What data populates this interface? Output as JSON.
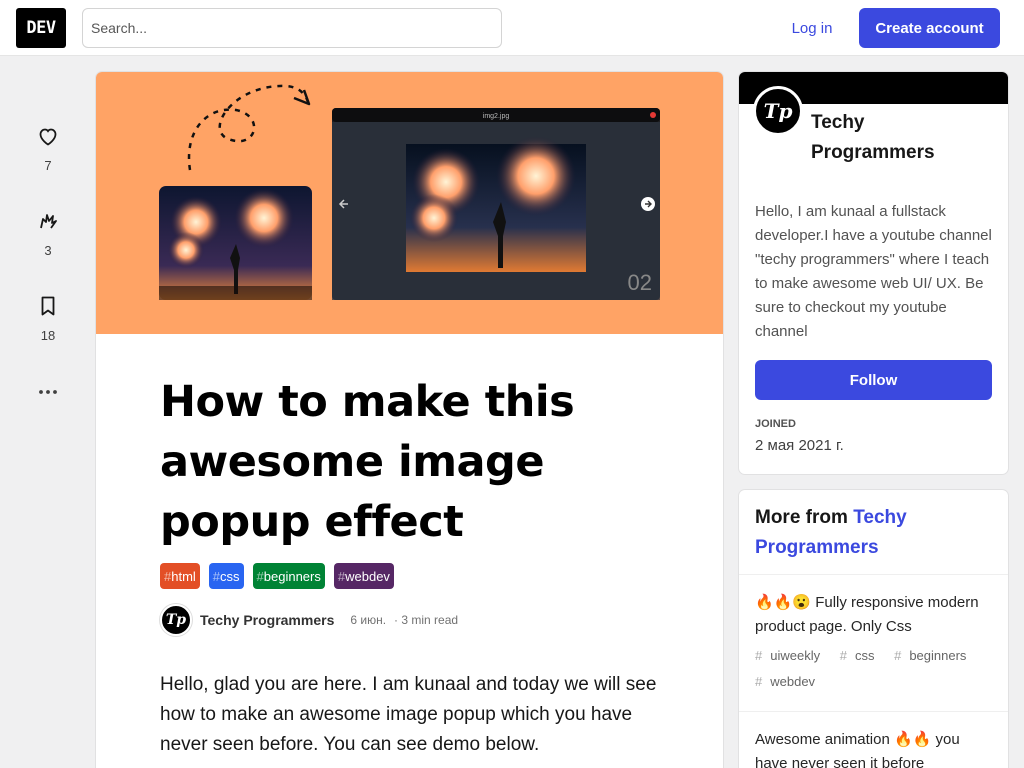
{
  "header": {
    "logo": "DEV",
    "search_placeholder": "Search...",
    "login_label": "Log in",
    "create_label": "Create account"
  },
  "reactions": [
    {
      "icon": "heart-icon",
      "count": "7"
    },
    {
      "icon": "unicorn-icon",
      "count": "3"
    },
    {
      "icon": "bookmark-icon",
      "count": "18"
    }
  ],
  "article": {
    "cover": {
      "viewer_filename": "img2.jpg",
      "slide_number": "02"
    },
    "title": "How to make this awesome image popup effect",
    "tags": [
      {
        "label": "html",
        "color": "#e34f26"
      },
      {
        "label": "css",
        "color": "#2965f1"
      },
      {
        "label": "beginners",
        "color": "#008335"
      },
      {
        "label": "webdev",
        "color": "#562765"
      }
    ],
    "author": "Techy Programmers",
    "avatar_initials": "Tp",
    "date": "6 июн.",
    "read_time": "3 min read",
    "body": "Hello, glad you are here. I am kunaal and today we will see how to make an awesome image popup which you have never seen before. You can see demo below."
  },
  "profile": {
    "avatar_initials": "Tp",
    "name": "Techy Programmers",
    "bio": "Hello, I am kunaal a fullstack developer.I have a youtube channel \"techy programmers\" where I teach to make awesome web UI/ UX. Be sure to checkout my youtube channel",
    "follow_label": "Follow",
    "joined_label": "JOINED",
    "joined_value": "2 мая 2021 г."
  },
  "more_from": {
    "prefix": "More from",
    "author": "Techy Programmers",
    "posts": [
      {
        "title": "🔥🔥😮 Fully responsive modern product page. Only Css",
        "tags": [
          "uiweekly",
          "css",
          "beginners",
          "webdev"
        ]
      },
      {
        "title": "Awesome animation 🔥🔥 you have never seen it before",
        "tags": []
      }
    ]
  },
  "colors": {
    "accent": "#3b49df",
    "cover_bg": "#ffa365"
  }
}
